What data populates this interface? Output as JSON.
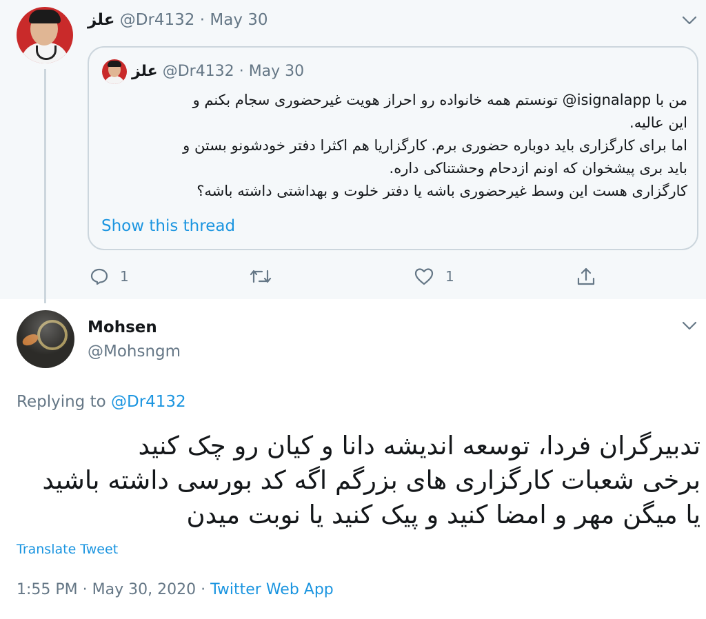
{
  "quoted_tweet": {
    "author_name": "علز",
    "handle": "@Dr4132",
    "separator": "·",
    "date": "May 30",
    "quote": {
      "author_name": "علز",
      "handle": "@Dr4132",
      "separator": "·",
      "date": "May 30",
      "lines": [
        "من با isignalapp@ تونستم همه خانواده رو احراز هویت غیرحضوری سجام بکنم و",
        "این عالیه.",
        "اما برای کارگزاری باید دوباره حضوری برم. کارگزاریا هم اکثرا دفتر خودشونو بستن و",
        "باید بری پیشخوان که اونم ازدحام وحشتناکی داره.",
        "کارگزاری هست این وسط غیرحضوری باشه یا دفتر خلوت و بهداشتی داشته باشه؟"
      ],
      "show_thread": "Show this thread"
    },
    "actions": {
      "reply_count": "1",
      "retweet_count": "",
      "like_count": "1"
    }
  },
  "main_tweet": {
    "author_name": "Mohsen",
    "handle": "@Mohsngm",
    "replying_prefix": "Replying to",
    "replying_to": "@Dr4132",
    "lines": [
      "تدبیرگران فردا، توسعه اندیشه دانا و کیان رو چک کنید",
      "برخی شعبات کارگزاری های بزرگم اگه کد بورسی داشته باشید",
      "یا میگن مهر و امضا کنید و پیک کنید یا نوبت میدن"
    ],
    "translate": "Translate Tweet",
    "time": "1:55 PM",
    "separator": "·",
    "date": "May 30, 2020",
    "source": "Twitter Web App"
  },
  "colors": {
    "accent": "#1b95e0",
    "secondary_text": "#657786",
    "top_background": "#f5f8fa",
    "border": "#ccd6dd"
  },
  "icons": [
    "chevron-down-icon",
    "reply-icon",
    "retweet-icon",
    "like-icon",
    "share-icon"
  ]
}
